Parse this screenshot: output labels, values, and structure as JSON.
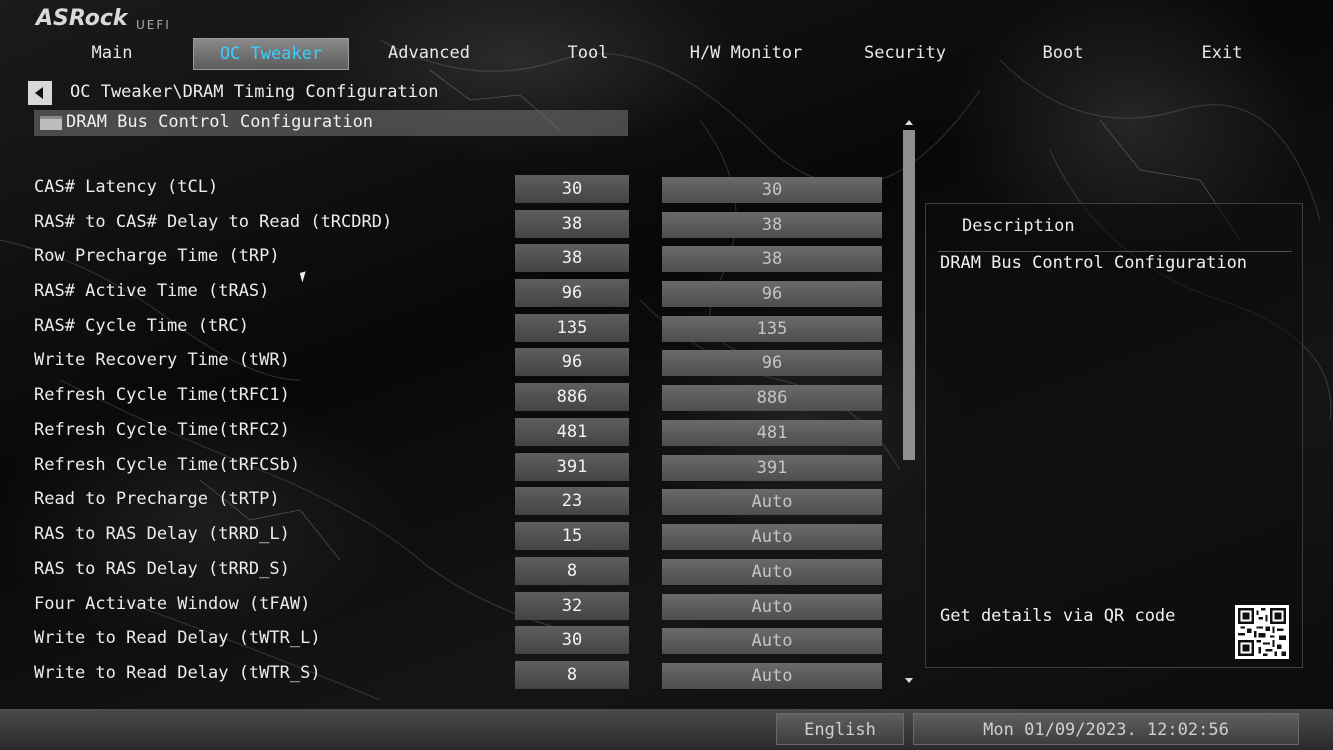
{
  "brand": {
    "logo": "ASRock",
    "sub": "UEFI"
  },
  "nav": {
    "tabs": [
      {
        "label": "Main",
        "active": false
      },
      {
        "label": "OC Tweaker",
        "active": true
      },
      {
        "label": "Advanced",
        "active": false
      },
      {
        "label": "Tool",
        "active": false
      },
      {
        "label": "H/W Monitor",
        "active": false
      },
      {
        "label": "Security",
        "active": false
      },
      {
        "label": "Boot",
        "active": false
      },
      {
        "label": "Exit",
        "active": false
      }
    ]
  },
  "breadcrumb": "OC Tweaker\\DRAM Timing Configuration",
  "section": {
    "label": "DRAM Bus Control Configuration",
    "icon": "folder-icon"
  },
  "rows": [
    {
      "label": "CAS# Latency (tCL)",
      "value": "30",
      "default": "30"
    },
    {
      "label": "RAS# to CAS# Delay to Read  (tRCDRD)",
      "value": "38",
      "default": "38"
    },
    {
      "label": "Row Precharge Time (tRP)",
      "value": "38",
      "default": "38"
    },
    {
      "label": "RAS# Active Time (tRAS)",
      "value": "96",
      "default": "96"
    },
    {
      "label": "RAS# Cycle Time (tRC)",
      "value": "135",
      "default": "135"
    },
    {
      "label": "Write Recovery Time (tWR)",
      "value": "96",
      "default": "96"
    },
    {
      "label": "Refresh Cycle Time(tRFC1)",
      "value": "886",
      "default": "886"
    },
    {
      "label": "Refresh Cycle Time(tRFC2)",
      "value": "481",
      "default": "481"
    },
    {
      "label": "Refresh Cycle Time(tRFCSb)",
      "value": "391",
      "default": "391"
    },
    {
      "label": "Read to Precharge (tRTP)",
      "value": "23",
      "default": "Auto"
    },
    {
      "label": "RAS to RAS Delay (tRRD_L)",
      "value": "15",
      "default": "Auto"
    },
    {
      "label": "RAS to RAS Delay (tRRD_S)",
      "value": "8",
      "default": "Auto"
    },
    {
      "label": "Four Activate Window (tFAW)",
      "value": "32",
      "default": "Auto"
    },
    {
      "label": "Write to Read Delay (tWTR_L)",
      "value": "30",
      "default": "Auto"
    },
    {
      "label": "Write to Read Delay (tWTR_S)",
      "value": "8",
      "default": "Auto"
    }
  ],
  "description": {
    "title": "Description",
    "text": "DRAM Bus Control Configuration",
    "qr_label": "Get details via QR code"
  },
  "footer": {
    "language": "English",
    "datetime": "Mon 01/09/2023. 12:02:56"
  },
  "colors": {
    "active_tab_text": "#36d0ff",
    "background": "#0d0d0d"
  }
}
